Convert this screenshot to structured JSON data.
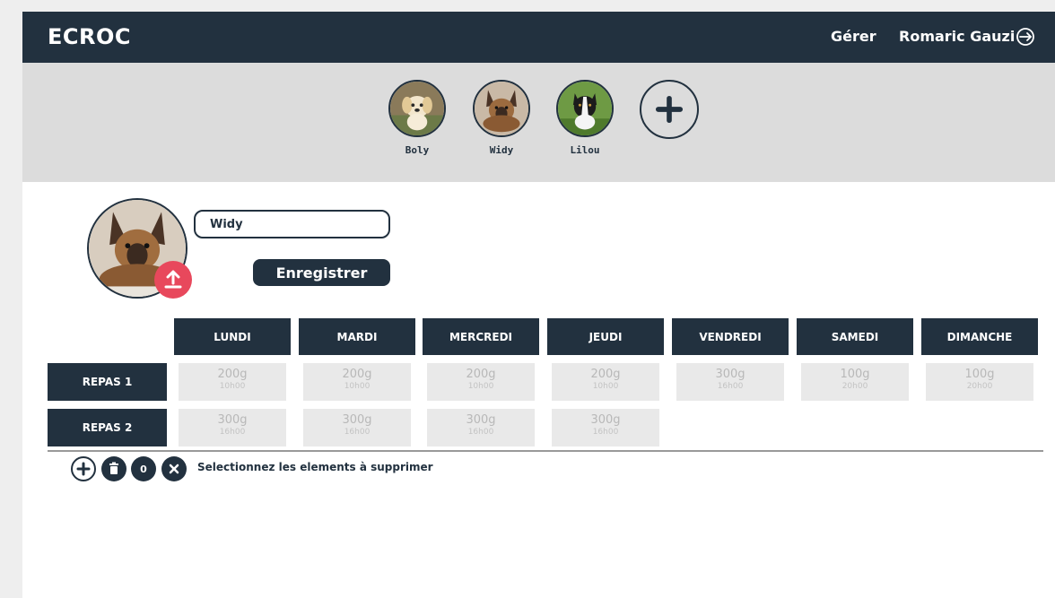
{
  "app": {
    "brand": "ECROC",
    "nav_manage": "Gérer",
    "user_name": "Romaric Gauzi"
  },
  "pets": [
    {
      "name": "Boly"
    },
    {
      "name": "Widy"
    },
    {
      "name": "Lilou"
    }
  ],
  "profile": {
    "name_value": "Widy",
    "save_label": "Enregistrer"
  },
  "schedule": {
    "days": [
      "LUNDI",
      "MARDI",
      "MERCREDI",
      "JEUDI",
      "VENDREDI",
      "SAMEDI",
      "DIMANCHE"
    ],
    "meals": [
      {
        "label": "REPAS 1",
        "cells": [
          {
            "qty": "200g",
            "time": "10h00"
          },
          {
            "qty": "200g",
            "time": "10h00"
          },
          {
            "qty": "200g",
            "time": "10h00"
          },
          {
            "qty": "200g",
            "time": "10h00"
          },
          {
            "qty": "300g",
            "time": "16h00"
          },
          {
            "qty": "100g",
            "time": "20h00"
          },
          {
            "qty": "100g",
            "time": "20h00"
          }
        ]
      },
      {
        "label": "REPAS 2",
        "cells": [
          {
            "qty": "300g",
            "time": "16h00"
          },
          {
            "qty": "300g",
            "time": "16h00"
          },
          {
            "qty": "300g",
            "time": "16h00"
          },
          {
            "qty": "300g",
            "time": "16h00"
          }
        ]
      }
    ]
  },
  "toolbar": {
    "count": "0",
    "helper_text": "Selectionnez les elements à supprimer"
  },
  "colors": {
    "primary": "#22313f",
    "accent": "#e8485c",
    "banner": "#dcdcdc",
    "cell": "#e9e9e9"
  },
  "icons": {
    "logout": "logout-icon",
    "add": "plus-icon",
    "upload": "upload-icon",
    "trash": "trash-icon",
    "close": "close-icon"
  }
}
